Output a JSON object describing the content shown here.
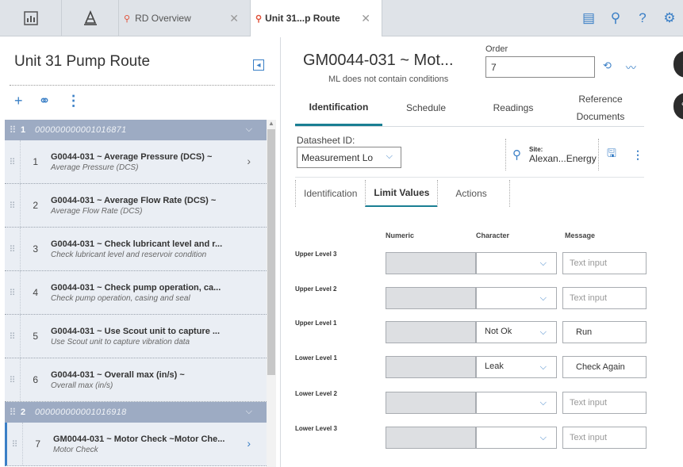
{
  "tabs": {
    "rd_overview": "RD Overview",
    "unit_route": "Unit 31...p Route"
  },
  "left": {
    "title": "Unit 31 Pump Route",
    "groups": [
      {
        "num": "1",
        "code": "000000000001016871",
        "items": [
          {
            "num": "1",
            "title": "G0044-031 ~ Average Pressure (DCS) ~",
            "subtitle": "Average Pressure (DCS)"
          },
          {
            "num": "2",
            "title": "G0044-031 ~ Average Flow Rate (DCS) ~",
            "subtitle": "Average Flow Rate (DCS)"
          },
          {
            "num": "3",
            "title": "G0044-031 ~ Check lubricant level and r...",
            "subtitle": "Check lubricant level and reservoir condition"
          },
          {
            "num": "4",
            "title": "G0044-031 ~ Check pump operation, ca...",
            "subtitle": "Check pump operation, casing and seal"
          },
          {
            "num": "5",
            "title": "G0044-031 ~ Use Scout unit to capture ...",
            "subtitle": "Use Scout unit to capture vibration data"
          },
          {
            "num": "6",
            "title": "G0044-031 ~ Overall max (in/s) ~",
            "subtitle": "Overall max (in/s)"
          }
        ]
      },
      {
        "num": "2",
        "code": "000000000001016918",
        "items": [
          {
            "num": "7",
            "title": "GM0044-031 ~ Motor Check ~Motor Che...",
            "subtitle": "Motor Check"
          }
        ]
      }
    ]
  },
  "right": {
    "title": "GM0044-031 ~ Mot...",
    "subtitle": "ML does not contain conditions",
    "order_label": "Order",
    "order_value": "7",
    "tabs": [
      "Identification",
      "Schedule",
      "Readings",
      "Reference Documents"
    ],
    "datasheet_label": "Datasheet ID:",
    "datasheet_value": "Measurement Lo",
    "site_label": "Site:",
    "site_value": "Alexan...Energy",
    "subtabs": [
      "Identification",
      "Limit Values",
      "Actions"
    ],
    "columns": {
      "numeric": "Numeric",
      "character": "Character",
      "message": "Message"
    },
    "limits": [
      {
        "label": "Upper Level 3",
        "character": "",
        "message": "",
        "placeholder": "Text input"
      },
      {
        "label": "Upper Level 2",
        "character": "",
        "message": "",
        "placeholder": "Text input"
      },
      {
        "label": "Upper Level 1",
        "character": "Not Ok",
        "message": "Run",
        "placeholder": "Text input"
      },
      {
        "label": "Lower Level 1",
        "character": "Leak",
        "message": "Check Again",
        "placeholder": "Text input"
      },
      {
        "label": "Lower Level 2",
        "character": "",
        "message": "",
        "placeholder": "Text input"
      },
      {
        "label": "Lower Level 3",
        "character": "",
        "message": "",
        "placeholder": "Text input"
      }
    ]
  },
  "colors": {
    "accent": "#3a7fc6",
    "tab_underline": "#1a7f93",
    "group_header": "#9dabc3",
    "item_bg": "#eaeef4"
  }
}
